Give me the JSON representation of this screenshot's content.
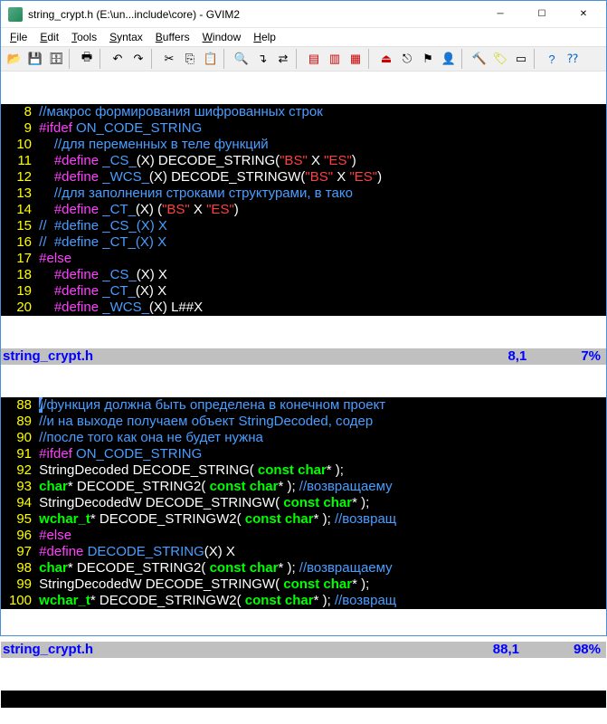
{
  "window": {
    "title": "string_crypt.h (E:\\un...include\\core) - GVIM2"
  },
  "menu": {
    "file": "File",
    "edit": "Edit",
    "tools": "Tools",
    "syntax": "Syntax",
    "buffers": "Buffers",
    "window": "Window",
    "help": "Help"
  },
  "pane1": {
    "lines": [
      {
        "n": "8",
        "seg": [
          {
            "c": "c-comment",
            "t": "//макрос формирования шифрованных строк"
          }
        ]
      },
      {
        "n": "9",
        "seg": [
          {
            "c": "c-pre",
            "t": "#ifdef"
          },
          {
            "c": "c-op",
            "t": " "
          },
          {
            "c": "c-macro",
            "t": "ON_CODE_STRING"
          }
        ]
      },
      {
        "n": "10",
        "seg": [
          {
            "c": "c-op",
            "t": "    "
          },
          {
            "c": "c-comment",
            "t": "//для переменных в теле функций"
          }
        ]
      },
      {
        "n": "11",
        "seg": [
          {
            "c": "c-op",
            "t": "    "
          },
          {
            "c": "c-pre",
            "t": "#define"
          },
          {
            "c": "c-op",
            "t": " "
          },
          {
            "c": "c-macro",
            "t": "_CS_"
          },
          {
            "c": "c-ident",
            "t": "(X) DECODE_STRING("
          },
          {
            "c": "c-str",
            "t": "\"BS\""
          },
          {
            "c": "c-ident",
            "t": " X "
          },
          {
            "c": "c-str",
            "t": "\"ES\""
          },
          {
            "c": "c-ident",
            "t": ")"
          }
        ]
      },
      {
        "n": "12",
        "seg": [
          {
            "c": "c-op",
            "t": "    "
          },
          {
            "c": "c-pre",
            "t": "#define"
          },
          {
            "c": "c-op",
            "t": " "
          },
          {
            "c": "c-macro",
            "t": "_WCS_"
          },
          {
            "c": "c-ident",
            "t": "(X) DECODE_STRINGW("
          },
          {
            "c": "c-str",
            "t": "\"BS\""
          },
          {
            "c": "c-ident",
            "t": " X "
          },
          {
            "c": "c-str",
            "t": "\"ES\""
          },
          {
            "c": "c-ident",
            "t": ")"
          }
        ]
      },
      {
        "n": "13",
        "seg": [
          {
            "c": "c-op",
            "t": "    "
          },
          {
            "c": "c-comment",
            "t": "//для заполнения строками структурами, в тако"
          }
        ]
      },
      {
        "n": "14",
        "seg": [
          {
            "c": "c-op",
            "t": "    "
          },
          {
            "c": "c-pre",
            "t": "#define"
          },
          {
            "c": "c-op",
            "t": " "
          },
          {
            "c": "c-macro",
            "t": "_CT_"
          },
          {
            "c": "c-ident",
            "t": "(X) ("
          },
          {
            "c": "c-str",
            "t": "\"BS\""
          },
          {
            "c": "c-ident",
            "t": " X "
          },
          {
            "c": "c-str",
            "t": "\"ES\""
          },
          {
            "c": "c-ident",
            "t": ")"
          }
        ]
      },
      {
        "n": "15",
        "seg": [
          {
            "c": "c-comment",
            "t": "//  #define _CS_(X) X"
          }
        ]
      },
      {
        "n": "16",
        "seg": [
          {
            "c": "c-comment",
            "t": "//  #define _CT_(X) X"
          }
        ]
      },
      {
        "n": "17",
        "seg": [
          {
            "c": "c-pre",
            "t": "#else"
          }
        ]
      },
      {
        "n": "18",
        "seg": [
          {
            "c": "c-op",
            "t": "    "
          },
          {
            "c": "c-pre",
            "t": "#define"
          },
          {
            "c": "c-op",
            "t": " "
          },
          {
            "c": "c-macro",
            "t": "_CS_"
          },
          {
            "c": "c-ident",
            "t": "(X) X"
          }
        ]
      },
      {
        "n": "19",
        "seg": [
          {
            "c": "c-op",
            "t": "    "
          },
          {
            "c": "c-pre",
            "t": "#define"
          },
          {
            "c": "c-op",
            "t": " "
          },
          {
            "c": "c-macro",
            "t": "_CT_"
          },
          {
            "c": "c-ident",
            "t": "(X) X"
          }
        ]
      },
      {
        "n": "20",
        "seg": [
          {
            "c": "c-op",
            "t": "    "
          },
          {
            "c": "c-pre",
            "t": "#define"
          },
          {
            "c": "c-op",
            "t": " "
          },
          {
            "c": "c-macro",
            "t": "_WCS_"
          },
          {
            "c": "c-ident",
            "t": "(X) L##X"
          }
        ]
      }
    ],
    "status_file": "string_crypt.h",
    "status_pos": "8,1",
    "status_pct": "7%"
  },
  "pane2": {
    "lines": [
      {
        "n": "88",
        "seg": [
          {
            "c": "cursor",
            "t": "/"
          },
          {
            "c": "c-comment",
            "t": "/функция должна быть определена в конечном проект"
          }
        ]
      },
      {
        "n": "89",
        "seg": [
          {
            "c": "c-comment",
            "t": "//и на выходе получаем объект StringDecoded, содер"
          }
        ]
      },
      {
        "n": "90",
        "seg": [
          {
            "c": "c-comment",
            "t": "//после того как она не будет нужна"
          }
        ]
      },
      {
        "n": "91",
        "seg": [
          {
            "c": "c-pre",
            "t": "#ifdef"
          },
          {
            "c": "c-op",
            "t": " "
          },
          {
            "c": "c-macro",
            "t": "ON_CODE_STRING"
          }
        ]
      },
      {
        "n": "92",
        "seg": [
          {
            "c": "c-ident",
            "t": "StringDecoded DECODE_STRING( "
          },
          {
            "c": "c-type",
            "t": "const"
          },
          {
            "c": "c-ident",
            "t": " "
          },
          {
            "c": "c-type",
            "t": "char"
          },
          {
            "c": "c-ident",
            "t": "* );"
          }
        ]
      },
      {
        "n": "93",
        "seg": [
          {
            "c": "c-type",
            "t": "char"
          },
          {
            "c": "c-ident",
            "t": "* DECODE_STRING2( "
          },
          {
            "c": "c-type",
            "t": "const"
          },
          {
            "c": "c-ident",
            "t": " "
          },
          {
            "c": "c-type",
            "t": "char"
          },
          {
            "c": "c-ident",
            "t": "* ); "
          },
          {
            "c": "c-comment",
            "t": "//возвращаему"
          }
        ]
      },
      {
        "n": "94",
        "seg": [
          {
            "c": "c-ident",
            "t": "StringDecodedW DECODE_STRINGW( "
          },
          {
            "c": "c-type",
            "t": "const"
          },
          {
            "c": "c-ident",
            "t": " "
          },
          {
            "c": "c-type",
            "t": "char"
          },
          {
            "c": "c-ident",
            "t": "* );"
          }
        ]
      },
      {
        "n": "95",
        "seg": [
          {
            "c": "c-type",
            "t": "wchar_t"
          },
          {
            "c": "c-ident",
            "t": "* DECODE_STRINGW2( "
          },
          {
            "c": "c-type",
            "t": "const"
          },
          {
            "c": "c-ident",
            "t": " "
          },
          {
            "c": "c-type",
            "t": "char"
          },
          {
            "c": "c-ident",
            "t": "* ); "
          },
          {
            "c": "c-comment",
            "t": "//возвращ"
          }
        ]
      },
      {
        "n": "96",
        "seg": [
          {
            "c": "c-pre",
            "t": "#else"
          }
        ]
      },
      {
        "n": "97",
        "seg": [
          {
            "c": "c-pre",
            "t": "#define"
          },
          {
            "c": "c-op",
            "t": " "
          },
          {
            "c": "c-macro",
            "t": "DECODE_STRING"
          },
          {
            "c": "c-ident",
            "t": "(X) X"
          }
        ]
      },
      {
        "n": "98",
        "seg": [
          {
            "c": "c-type",
            "t": "char"
          },
          {
            "c": "c-ident",
            "t": "* DECODE_STRING2( "
          },
          {
            "c": "c-type",
            "t": "const"
          },
          {
            "c": "c-ident",
            "t": " "
          },
          {
            "c": "c-type",
            "t": "char"
          },
          {
            "c": "c-ident",
            "t": "* ); "
          },
          {
            "c": "c-comment",
            "t": "//возвращаему"
          }
        ]
      },
      {
        "n": "99",
        "seg": [
          {
            "c": "c-ident",
            "t": "StringDecodedW DECODE_STRINGW( "
          },
          {
            "c": "c-type",
            "t": "const"
          },
          {
            "c": "c-ident",
            "t": " "
          },
          {
            "c": "c-type",
            "t": "char"
          },
          {
            "c": "c-ident",
            "t": "* );"
          }
        ]
      },
      {
        "n": "100",
        "seg": [
          {
            "c": "c-type",
            "t": "wchar_t"
          },
          {
            "c": "c-ident",
            "t": "* DECODE_STRINGW2( "
          },
          {
            "c": "c-type",
            "t": "const"
          },
          {
            "c": "c-ident",
            "t": " "
          },
          {
            "c": "c-type",
            "t": "char"
          },
          {
            "c": "c-ident",
            "t": "* ); "
          },
          {
            "c": "c-comment",
            "t": "//возвращ"
          }
        ]
      }
    ],
    "status_file": "string_crypt.h",
    "status_pos": "88,1",
    "status_pct": "98%"
  }
}
